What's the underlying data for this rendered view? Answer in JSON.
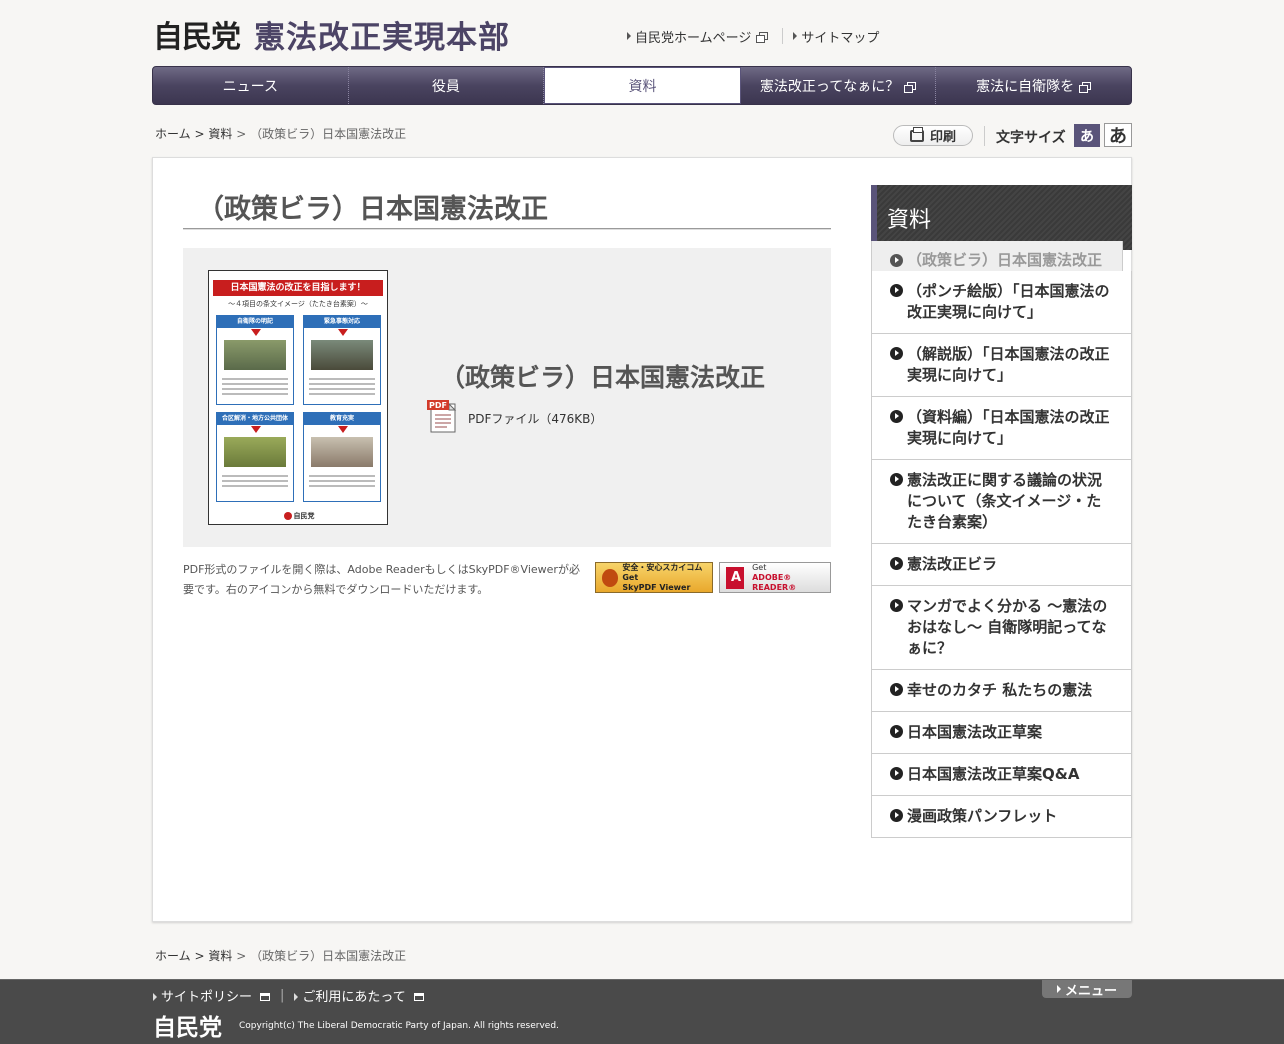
{
  "header": {
    "party": "自民党",
    "hq": "憲法改正実現本部",
    "links": [
      {
        "label": "自民党ホームページ"
      },
      {
        "label": "サイトマップ"
      }
    ]
  },
  "nav": {
    "tabs": [
      {
        "label": "ニュース"
      },
      {
        "label": "役員"
      },
      {
        "label": "資料"
      },
      {
        "label": "憲法改正ってなぁに？"
      },
      {
        "label": "憲法に自衛隊を"
      }
    ],
    "active_index": 2
  },
  "breadcrumb": {
    "home": "ホーム",
    "sep": ">",
    "section": "資料",
    "current": "（政策ビラ）日本国憲法改正"
  },
  "tools": {
    "print": "印刷",
    "font_size": "文字サイズ",
    "small": "あ",
    "large": "あ"
  },
  "main": {
    "title": "（政策ビラ）日本国憲法改正",
    "doc_title": "（政策ビラ）日本国憲法改正",
    "pdf_label": "PDFファイル（476KB）",
    "pdf_icon_text": "PDF",
    "note": "PDF形式のファイルを開く際は、Adobe ReaderもしくはSkyPDF®Viewerが必要です。右のアイコンから無料でダウンロードいただけます。",
    "skypdf_line1": "安全・安心スカイコム Get",
    "skypdf_line2": "SkyPDF Viewer",
    "adobe_line1": "Get",
    "adobe_line2": "ADOBE® READER®"
  },
  "flyer": {
    "headline": "日本国憲法の改正を目指します！",
    "sub": "〜４項目の条文イメージ（たたき台素案）〜",
    "blocks": [
      "自衛隊の明記",
      "緊急事態対応",
      "合区解消・地方公共団体",
      "教育充実"
    ],
    "logo": "自民党"
  },
  "sidebar": {
    "title": "資料",
    "items": [
      {
        "label": "（政策ビラ）日本国憲法改正"
      },
      {
        "label": "（ポンチ絵版）「日本国憲法の改正実現に向けて」"
      },
      {
        "label": "（解説版）「日本国憲法の改正実現に向けて」"
      },
      {
        "label": "（資料編）「日本国憲法の改正実現に向けて」"
      },
      {
        "label": "憲法改正に関する議論の状況について（条文イメージ・たたき台素案）"
      },
      {
        "label": "憲法改正ビラ"
      },
      {
        "label": "マンガでよく分かる ～憲法のおはなし～ 自衛隊明記ってなぁに？"
      },
      {
        "label": "幸せのカタチ 私たちの憲法"
      },
      {
        "label": "日本国憲法改正草案"
      },
      {
        "label": "日本国憲法改正草案Q&A"
      },
      {
        "label": "漫画政策パンフレット"
      }
    ],
    "current_index": 0
  },
  "footer": {
    "links": [
      {
        "label": "サイトポリシー"
      },
      {
        "label": "ご利用にあたって"
      }
    ],
    "sep": "|",
    "menu": "メニュー",
    "logo": "自民党",
    "copyright": "Copyright(c) The Liberal Democratic Party of Japan. All rights reserved."
  },
  "colors": {
    "brand": "#4c4466",
    "nav_bg": "#4a4460",
    "footer_bg": "#4a4a4a",
    "flyer_red": "#c81e1e",
    "flyer_blue": "#2e6fb8"
  }
}
